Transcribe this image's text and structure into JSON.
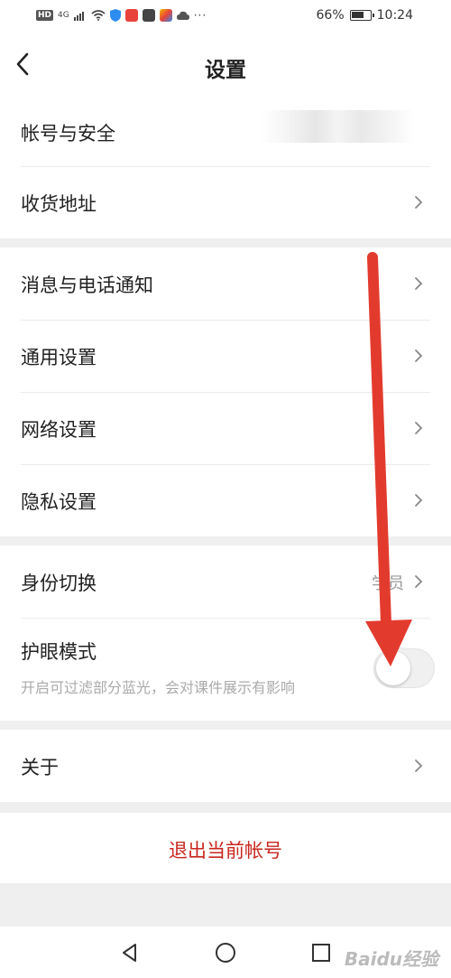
{
  "status_bar": {
    "signal_label": "4G",
    "battery": "66%",
    "battery_level": 0.66,
    "time": "10:24",
    "more": "···"
  },
  "header": {
    "title": "设置",
    "back_icon": "chevron-left-icon"
  },
  "groups": [
    {
      "items": [
        {
          "label": "帐号与安全",
          "value_hidden": true
        },
        {
          "label": "收货地址"
        }
      ]
    },
    {
      "items": [
        {
          "label": "消息与电话通知"
        },
        {
          "label": "通用设置"
        },
        {
          "label": "网络设置"
        },
        {
          "label": "隐私设置"
        }
      ]
    },
    {
      "items": [
        {
          "label": "身份切换",
          "value": "学员"
        },
        {
          "label": "护眼模式",
          "subtitle": "开启可过滤部分蓝光，会对课件展示有影响",
          "toggle_on": false
        }
      ]
    },
    {
      "items": [
        {
          "label": "关于"
        }
      ]
    }
  ],
  "logout_label": "退出当前帐号",
  "colors": {
    "accent_red": "#c8271f",
    "arrow_red": "#e23b2e",
    "background": "#efefef"
  },
  "system_nav": [
    "back-triangle-icon",
    "home-circle-icon",
    "recents-square-icon"
  ],
  "watermark": "Baidu经验"
}
